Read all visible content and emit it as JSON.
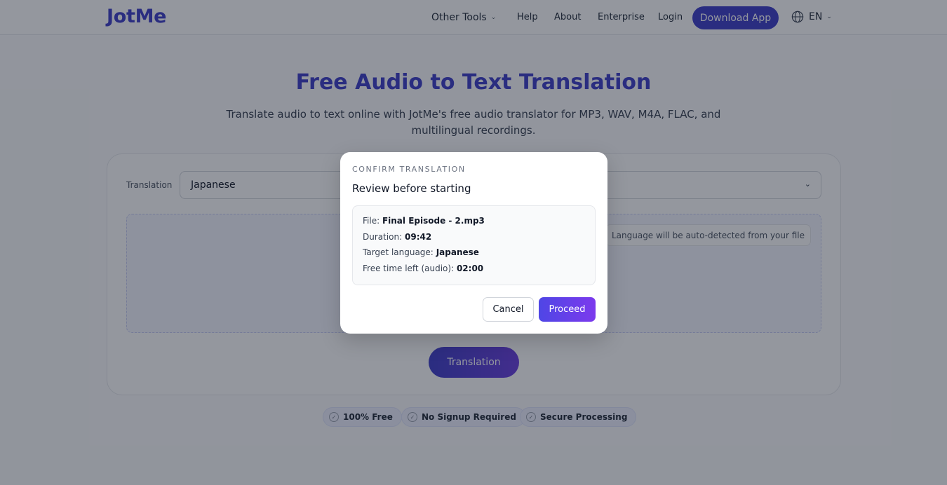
{
  "header": {
    "logo": "JotMe",
    "nav": {
      "other_tools": "Other Tools",
      "help": "Help",
      "about": "About",
      "enterprise": "Enterprise",
      "login": "Login"
    },
    "download_label": "Download App",
    "language": "EN"
  },
  "hero": {
    "title": "Free Audio to Text Translation",
    "subtitle": "Translate audio to text online with JotMe's free audio translator for MP3, WAV, M4A, FLAC, and multilingual recordings."
  },
  "form": {
    "translation_label": "Translation",
    "selected_language": "Japanese",
    "auto_detect_note": "Language will be auto-detected from your file",
    "submit_label": "Translation"
  },
  "badges": [
    "100% Free",
    "No Signup Required",
    "Secure Processing"
  ],
  "modal": {
    "eyebrow": "CONFIRM TRANSLATION",
    "title": "Review before starting",
    "file_label": "File:",
    "file_value": "Final Episode - 2.mp3",
    "duration_label": "Duration:",
    "duration_value": "09:42",
    "target_label": "Target language:",
    "target_value": "Japanese",
    "free_label": "Free time left (audio):",
    "free_value": "02:00",
    "cancel_label": "Cancel",
    "proceed_label": "Proceed"
  },
  "colors": {
    "brand": "#3f3fc9",
    "accent_gradient_start": "#4f46e5",
    "accent_gradient_end": "#7c3aed"
  }
}
